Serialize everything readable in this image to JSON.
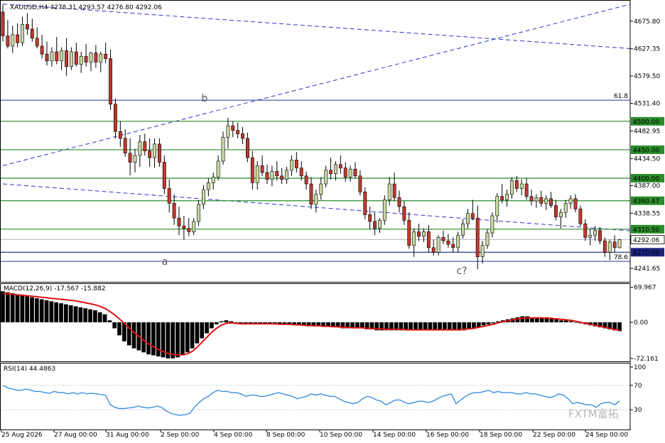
{
  "header": {
    "main": "XAUUSD,H4  4278.31 4293.57 4276.80 4292.06",
    "macd": "MACD(12,26,9) -17.567 -15.882",
    "rsi": "RSI(14) 44.4863"
  },
  "watermark": "FXTM富拓",
  "wave_labels": [
    {
      "text": "a",
      "price": 4248
    },
    {
      "text": "b",
      "price": 4535
    },
    {
      "text": "c?",
      "price": 4232
    }
  ],
  "colors": {
    "bull": "#c8d9a0",
    "bear": "#c0392b",
    "wick": "#000000",
    "level_line": "#2a8c2a",
    "trendline": "#2a35c8",
    "fib_line": "#283593",
    "macd_hist": "#000000",
    "macd_signal": "#dd1111",
    "rsi": "#3d8fde",
    "axis": "#000000",
    "label_bg_green": "#2a8c2a",
    "label_bg_navy": "#1a237e"
  },
  "chart_data": [
    {
      "type": "candlestick",
      "symbol": "XAUUSD",
      "timeframe": "H4",
      "last": {
        "open": 4278.31,
        "high": 4293.57,
        "low": 4276.8,
        "close": 4292.06
      },
      "y_ticks": [
        "4675.80",
        "4627.35",
        "4579.50",
        "4531.40",
        "4482.95",
        "4434.50",
        "4387.00",
        "4338.55",
        "4290.10",
        "4241.65"
      ],
      "ylim": [
        4218,
        4713
      ],
      "x_tick_labels": [
        "25 Aug 2026",
        "27 Aug 00:00",
        "31 Aug 00:00",
        "2 Sep 00:00",
        "4 Sep 00:00",
        "8 Sep 00:00",
        "10 Sep 00:00",
        "14 Sep 00:00",
        "16 Sep 00:00",
        "18 Sep 00:00",
        "22 Sep 00:00",
        "24 Sep 00:00"
      ],
      "horizontal_levels": [
        {
          "label": "4500.00",
          "price": 4500.0,
          "style": "green"
        },
        {
          "label": "4450.00",
          "price": 4450.0,
          "style": "green"
        },
        {
          "label": "4400.00",
          "price": 4400.0,
          "style": "green"
        },
        {
          "label": "4360.47",
          "price": 4360.47,
          "style": "green"
        },
        {
          "label": "4310.50",
          "price": 4310.5,
          "style": "green"
        },
        {
          "label": "4270.00",
          "price": 4270.0,
          "style": "navy"
        }
      ],
      "fib_levels": [
        {
          "label": "61.8",
          "price": 4537
        },
        {
          "label": "78.6",
          "price": 4254
        }
      ],
      "current_price": {
        "label": "4292.06",
        "price": 4292.06
      },
      "trendlines": [
        {
          "from": [
            0,
            4422
          ],
          "to": [
            141,
            4734
          ]
        },
        {
          "from": [
            0,
            4706
          ],
          "to": [
            288,
            4530
          ]
        },
        {
          "from": [
            288,
            4530
          ],
          "to": [
            281,
            4214
          ]
        },
        {
          "from": [
            0,
            4390
          ],
          "to": [
            280,
            4210
          ]
        }
      ],
      "candles": [
        [
          4692,
          4705,
          4640,
          4650
        ],
        [
          4650,
          4678,
          4628,
          4632
        ],
        [
          4632,
          4668,
          4620,
          4652
        ],
        [
          4652,
          4672,
          4630,
          4638
        ],
        [
          4638,
          4684,
          4632,
          4670
        ],
        [
          4670,
          4690,
          4652,
          4662
        ],
        [
          4662,
          4680,
          4640,
          4646
        ],
        [
          4646,
          4665,
          4628,
          4632
        ],
        [
          4632,
          4652,
          4610,
          4618
        ],
        [
          4618,
          4640,
          4598,
          4606
        ],
        [
          4606,
          4630,
          4596,
          4622
        ],
        [
          4622,
          4648,
          4600,
          4606
        ],
        [
          4606,
          4630,
          4590,
          4624
        ],
        [
          4624,
          4646,
          4580,
          4596
        ],
        [
          4596,
          4630,
          4590,
          4622
        ],
        [
          4622,
          4638,
          4596,
          4600
        ],
        [
          4600,
          4622,
          4585,
          4614
        ],
        [
          4614,
          4636,
          4596,
          4604
        ],
        [
          4604,
          4622,
          4588,
          4620
        ],
        [
          4620,
          4634,
          4594,
          4604
        ],
        [
          4604,
          4622,
          4586,
          4618
        ],
        [
          4618,
          4638,
          4602,
          4610
        ],
        [
          4610,
          4626,
          4520,
          4530
        ],
        [
          4530,
          4540,
          4470,
          4482
        ],
        [
          4482,
          4500,
          4455,
          4470
        ],
        [
          4470,
          4486,
          4438,
          4444
        ],
        [
          4444,
          4470,
          4405,
          4428
        ],
        [
          4428,
          4452,
          4410,
          4440
        ],
        [
          4440,
          4476,
          4420,
          4464
        ],
        [
          4464,
          4478,
          4440,
          4448
        ],
        [
          4448,
          4470,
          4420,
          4436
        ],
        [
          4436,
          4470,
          4418,
          4460
        ],
        [
          4460,
          4470,
          4420,
          4428
        ],
        [
          4428,
          4440,
          4372,
          4382
        ],
        [
          4382,
          4398,
          4340,
          4356
        ],
        [
          4356,
          4372,
          4318,
          4330
        ],
        [
          4330,
          4350,
          4300,
          4316
        ],
        [
          4316,
          4334,
          4292,
          4312
        ],
        [
          4312,
          4330,
          4298,
          4306
        ],
        [
          4306,
          4330,
          4300,
          4324
        ],
        [
          4324,
          4362,
          4316,
          4354
        ],
        [
          4354,
          4388,
          4346,
          4380
        ],
        [
          4380,
          4400,
          4368,
          4392
        ],
        [
          4392,
          4410,
          4380,
          4402
        ],
        [
          4402,
          4440,
          4396,
          4430
        ],
        [
          4430,
          4482,
          4424,
          4472
        ],
        [
          4472,
          4506,
          4452,
          4492
        ],
        [
          4492,
          4500,
          4472,
          4484
        ],
        [
          4484,
          4498,
          4470,
          4478
        ],
        [
          4478,
          4490,
          4460,
          4470
        ],
        [
          4470,
          4480,
          4428,
          4436
        ],
        [
          4436,
          4448,
          4380,
          4392
        ],
        [
          4392,
          4430,
          4380,
          4422
        ],
        [
          4422,
          4440,
          4404,
          4410
        ],
        [
          4410,
          4424,
          4390,
          4398
        ],
        [
          4398,
          4422,
          4386,
          4412
        ],
        [
          4412,
          4430,
          4396,
          4404
        ],
        [
          4404,
          4418,
          4390,
          4398
        ],
        [
          4398,
          4420,
          4390,
          4414
        ],
        [
          4414,
          4440,
          4404,
          4432
        ],
        [
          4432,
          4446,
          4410,
          4418
        ],
        [
          4418,
          4430,
          4396,
          4404
        ],
        [
          4404,
          4412,
          4380,
          4390
        ],
        [
          4390,
          4402,
          4346,
          4354
        ],
        [
          4354,
          4380,
          4340,
          4372
        ],
        [
          4372,
          4402,
          4362,
          4390
        ],
        [
          4390,
          4422,
          4384,
          4414
        ],
        [
          4414,
          4436,
          4398,
          4408
        ],
        [
          4408,
          4430,
          4396,
          4424
        ],
        [
          4424,
          4440,
          4408,
          4418
        ],
        [
          4418,
          4428,
          4394,
          4402
        ],
        [
          4402,
          4422,
          4394,
          4416
        ],
        [
          4416,
          4428,
          4400,
          4404
        ],
        [
          4404,
          4414,
          4370,
          4376
        ],
        [
          4376,
          4384,
          4328,
          4336
        ],
        [
          4336,
          4350,
          4310,
          4324
        ],
        [
          4324,
          4340,
          4300,
          4312
        ],
        [
          4312,
          4330,
          4304,
          4326
        ],
        [
          4326,
          4370,
          4318,
          4362
        ],
        [
          4362,
          4402,
          4352,
          4390
        ],
        [
          4390,
          4410,
          4360,
          4366
        ],
        [
          4366,
          4378,
          4340,
          4350
        ],
        [
          4350,
          4360,
          4318,
          4326
        ],
        [
          4326,
          4340,
          4276,
          4282
        ],
        [
          4282,
          4312,
          4262,
          4306
        ],
        [
          4306,
          4320,
          4290,
          4298
        ],
        [
          4298,
          4312,
          4288,
          4306
        ],
        [
          4306,
          4318,
          4270,
          4278
        ],
        [
          4278,
          4292,
          4264,
          4270
        ],
        [
          4270,
          4300,
          4264,
          4296
        ],
        [
          4296,
          4308,
          4284,
          4290
        ],
        [
          4290,
          4302,
          4278,
          4284
        ],
        [
          4284,
          4296,
          4270,
          4278
        ],
        [
          4278,
          4306,
          4270,
          4300
        ],
        [
          4300,
          4328,
          4294,
          4320
        ],
        [
          4320,
          4346,
          4312,
          4338
        ],
        [
          4338,
          4362,
          4326,
          4330
        ],
        [
          4330,
          4352,
          4240,
          4262
        ],
        [
          4262,
          4290,
          4250,
          4282
        ],
        [
          4282,
          4310,
          4276,
          4304
        ],
        [
          4304,
          4340,
          4296,
          4334
        ],
        [
          4334,
          4374,
          4322,
          4368
        ],
        [
          4368,
          4390,
          4356,
          4362
        ],
        [
          4362,
          4380,
          4350,
          4372
        ],
        [
          4372,
          4402,
          4364,
          4396
        ],
        [
          4396,
          4404,
          4376,
          4382
        ],
        [
          4382,
          4398,
          4370,
          4390
        ],
        [
          4390,
          4400,
          4362,
          4368
        ],
        [
          4368,
          4380,
          4352,
          4360
        ],
        [
          4360,
          4372,
          4348,
          4366
        ],
        [
          4366,
          4378,
          4350,
          4356
        ],
        [
          4356,
          4370,
          4344,
          4364
        ],
        [
          4364,
          4376,
          4348,
          4352
        ],
        [
          4352,
          4362,
          4326,
          4332
        ],
        [
          4332,
          4346,
          4312,
          4340
        ],
        [
          4340,
          4362,
          4330,
          4356
        ],
        [
          4356,
          4370,
          4346,
          4364
        ],
        [
          4364,
          4372,
          4340,
          4346
        ],
        [
          4346,
          4352,
          4316,
          4320
        ],
        [
          4320,
          4328,
          4290,
          4296
        ],
        [
          4296,
          4312,
          4282,
          4300
        ],
        [
          4300,
          4316,
          4290,
          4308
        ],
        [
          4308,
          4314,
          4284,
          4290
        ],
        [
          4290,
          4296,
          4262,
          4270
        ],
        [
          4270,
          4292,
          4256,
          4288
        ],
        [
          4288,
          4300,
          4270,
          4278
        ],
        [
          4278,
          4293.57,
          4276.8,
          4292.06
        ]
      ]
    },
    {
      "type": "bar",
      "name": "MACD(12,26,9)",
      "values_text": {
        "main": "-17.567",
        "signal": "-15.882"
      },
      "y_ticks": [
        "69.967",
        "0.00",
        "-72.161"
      ],
      "ylim": [
        -78,
        78
      ],
      "histogram": [
        62,
        60,
        58,
        56,
        54,
        52,
        50,
        48,
        46,
        44,
        42,
        40,
        38,
        36,
        34,
        32,
        30,
        28,
        26,
        24,
        20,
        16,
        4,
        -12,
        -26,
        -38,
        -46,
        -52,
        -56,
        -60,
        -64,
        -66,
        -68,
        -70,
        -72,
        -72,
        -70,
        -66,
        -60,
        -52,
        -42,
        -32,
        -22,
        -12,
        -4,
        2,
        4,
        2,
        0,
        -2,
        -2,
        -4,
        -4,
        -4,
        -4,
        -4,
        -4,
        -4,
        -4,
        -4,
        -4,
        -4,
        -6,
        -8,
        -8,
        -8,
        -8,
        -8,
        -8,
        -10,
        -12,
        -12,
        -12,
        -12,
        -12,
        -14,
        -14,
        -16,
        -16,
        -16,
        -16,
        -16,
        -16,
        -16,
        -16,
        -16,
        -16,
        -16,
        -16,
        -16,
        -16,
        -16,
        -16,
        -16,
        -16,
        -16,
        -14,
        -12,
        -10,
        -6,
        -4,
        -2,
        2,
        4,
        6,
        8,
        10,
        12,
        12,
        10,
        10,
        10,
        10,
        8,
        6,
        4,
        4,
        2,
        0,
        -2,
        -4,
        -6,
        -8,
        -10,
        -12,
        -14,
        -16,
        -17.567
      ],
      "signal": [
        58,
        57,
        56,
        55,
        54,
        53,
        52,
        51,
        50,
        49,
        48,
        47,
        46,
        45,
        44,
        43,
        41,
        39,
        37,
        35,
        32,
        28,
        22,
        15,
        7,
        -2,
        -11,
        -20,
        -28,
        -36,
        -43,
        -49,
        -54,
        -58,
        -62,
        -64,
        -65,
        -65,
        -63,
        -58,
        -50,
        -40,
        -30,
        -20,
        -12,
        -6,
        -2,
        -1,
        -2,
        -3,
        -3,
        -3,
        -3,
        -3,
        -3,
        -3,
        -3,
        -4,
        -4,
        -4,
        -5,
        -5,
        -6,
        -6,
        -7,
        -7,
        -8,
        -8,
        -9,
        -9,
        -10,
        -10,
        -11,
        -11,
        -11,
        -12,
        -12,
        -13,
        -13,
        -14,
        -14,
        -14,
        -14,
        -15,
        -15,
        -15,
        -15,
        -15,
        -15,
        -15,
        -15,
        -15,
        -15,
        -15,
        -15,
        -14,
        -13,
        -12,
        -10,
        -8,
        -6,
        -4,
        -1,
        1,
        3,
        5,
        7,
        8,
        9,
        9,
        9,
        9,
        8,
        8,
        7,
        6,
        5,
        4,
        2,
        0,
        -2,
        -4,
        -6,
        -8,
        -10,
        -12,
        -14,
        -15.882
      ]
    },
    {
      "type": "line",
      "name": "RSI(14)",
      "last_value": 44.4863,
      "y_ticks": [
        "100",
        "70",
        "30"
      ],
      "ylim": [
        0,
        100
      ],
      "values": [
        70,
        66,
        64,
        62,
        62,
        64,
        62,
        60,
        60,
        58,
        57,
        60,
        58,
        58,
        56,
        58,
        56,
        58,
        56,
        57,
        56,
        55,
        54,
        38,
        34,
        32,
        32,
        33,
        34,
        36,
        34,
        33,
        34,
        36,
        34,
        28,
        24,
        22,
        21,
        22,
        24,
        34,
        42,
        48,
        52,
        58,
        62,
        60,
        60,
        58,
        58,
        56,
        52,
        54,
        54,
        52,
        52,
        54,
        56,
        58,
        56,
        54,
        52,
        48,
        50,
        52,
        56,
        54,
        56,
        54,
        52,
        52,
        48,
        44,
        42,
        40,
        42,
        48,
        52,
        50,
        46,
        44,
        38,
        42,
        46,
        46,
        42,
        40,
        42,
        44,
        44,
        42,
        44,
        48,
        52,
        54,
        56,
        40,
        46,
        52,
        56,
        58,
        58,
        60,
        62,
        58,
        60,
        58,
        58,
        58,
        56,
        56,
        58,
        56,
        56,
        54,
        52,
        50,
        52,
        56,
        54,
        48,
        40,
        42,
        40,
        38,
        38,
        34,
        40,
        42,
        42,
        38,
        44.4863
      ]
    }
  ]
}
